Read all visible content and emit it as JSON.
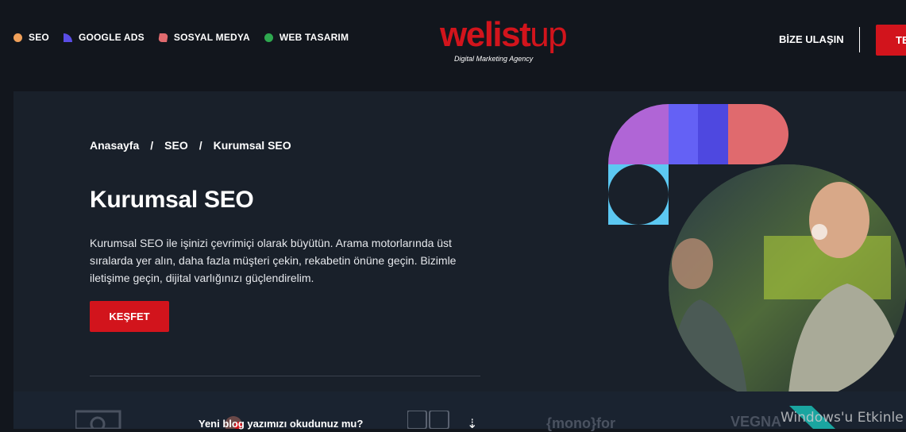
{
  "header": {
    "nav": [
      {
        "label": "SEO",
        "color": "#f0a05a",
        "icon": "circle-dot-icon"
      },
      {
        "label": "GOOGLE ADS",
        "color": "#5a4de6",
        "icon": "quarter-dot-icon"
      },
      {
        "label": "SOSYAL MEDYA",
        "color": "#e06a6e",
        "icon": "leaf-dot-icon"
      },
      {
        "label": "WEB TASARIM",
        "color": "#2ea84f",
        "icon": "circle-dot-icon"
      }
    ],
    "logo": {
      "word_main": "welist",
      "word_up": "up",
      "tagline": "Digital Marketing Agency"
    },
    "contact_label": "BİZE ULAŞIN",
    "cta_label": "TE"
  },
  "hero": {
    "breadcrumb": [
      "Anasayfa",
      "SEO",
      "Kurumsal SEO"
    ],
    "breadcrumb_sep": "/",
    "title": "Kurumsal SEO",
    "description": "Kurumsal SEO ile işinizi çevrimiçi olarak büyütün. Arama motorlarında üst sıralarda yer alın, daha fazla müşteri çekin, rekabetin önüne geçin. Bizimle iletişime geçin, dijital varlığınızı güçlendirelim.",
    "button_label": "KEŞFET"
  },
  "strip": {
    "read_more": "Yeni blog yazımızı okudunuz mu?",
    "partner_logos": [
      "{mono}for",
      "VEGNA"
    ]
  },
  "watermark": "Windows'u Etkinle",
  "colors": {
    "accent": "#d2141c",
    "purple": "#b065d6",
    "indigo": "#5b57f0",
    "coral": "#e06a6e",
    "sky": "#5cc8f2"
  }
}
